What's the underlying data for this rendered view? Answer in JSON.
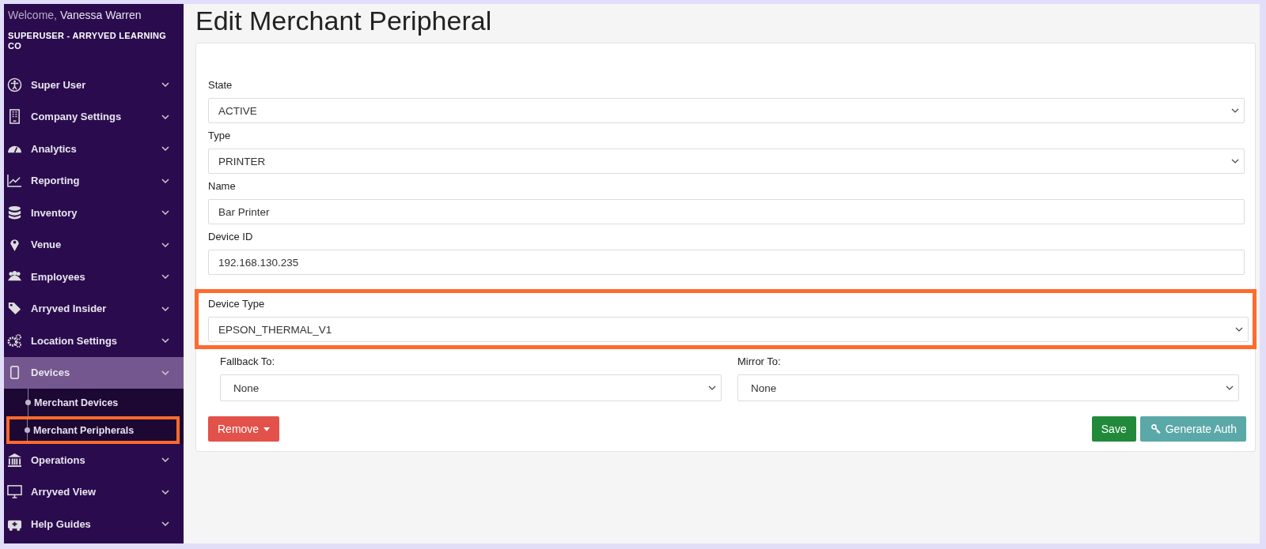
{
  "sidebar": {
    "welcome": "Welcome,",
    "user": "Vanessa Warren",
    "account": "SUPERUSER - ARRYVED LEARNING CO",
    "items": [
      {
        "label": "Super User",
        "expanded": false
      },
      {
        "label": "Company Settings",
        "expanded": false
      },
      {
        "label": "Analytics",
        "expanded": false
      },
      {
        "label": "Reporting",
        "expanded": false
      },
      {
        "label": "Inventory",
        "expanded": false
      },
      {
        "label": "Venue",
        "expanded": false
      },
      {
        "label": "Employees",
        "expanded": false
      },
      {
        "label": "Arryved Insider",
        "expanded": false
      },
      {
        "label": "Location Settings",
        "expanded": false
      },
      {
        "label": "Devices",
        "expanded": true,
        "children": [
          {
            "label": "Merchant Devices",
            "highlighted": false
          },
          {
            "label": "Merchant Peripherals",
            "highlighted": true
          }
        ]
      },
      {
        "label": "Operations",
        "expanded": false
      },
      {
        "label": "Arryved View",
        "expanded": false
      },
      {
        "label": "Help Guides",
        "expanded": false
      }
    ]
  },
  "title": "Edit Merchant Peripheral",
  "fields": [
    {
      "label": "State",
      "kind": "select",
      "value": "ACTIVE",
      "highlighted": false
    },
    {
      "label": "Type",
      "kind": "select",
      "value": "PRINTER",
      "highlighted": false
    },
    {
      "label": "Name",
      "kind": "text",
      "value": "Bar Printer",
      "highlighted": false
    },
    {
      "label": "Device ID",
      "kind": "text",
      "value": "192.168.130.235",
      "highlighted": false
    },
    {
      "label": "Device Type",
      "kind": "select",
      "value": "EPSON_THERMAL_V1",
      "highlighted": true
    }
  ],
  "pair": [
    {
      "label": "Fallback To:",
      "value": "None"
    },
    {
      "label": "Mirror To:",
      "value": "None"
    }
  ],
  "buttons": {
    "remove": "Remove",
    "save": "Save",
    "generate": "Generate Auth"
  }
}
